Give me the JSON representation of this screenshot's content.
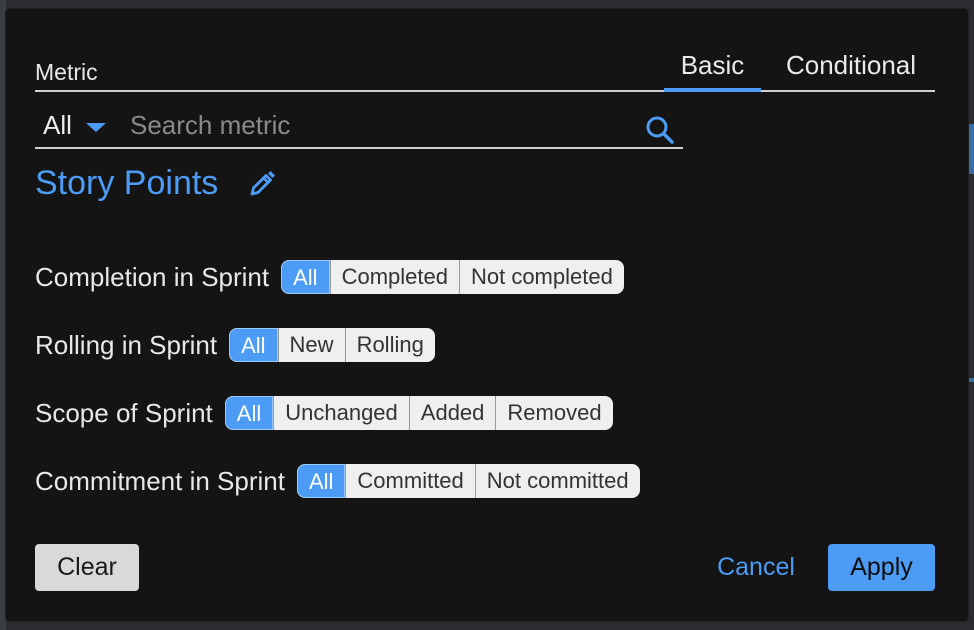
{
  "metric": {
    "label": "Metric",
    "scope_value": "All",
    "search_placeholder": "Search metric",
    "selected_title": "Story Points"
  },
  "tabs": [
    {
      "label": "Basic",
      "active": true
    },
    {
      "label": "Conditional",
      "active": false
    }
  ],
  "filters": [
    {
      "label": "Completion in Sprint",
      "options": [
        "All",
        "Completed",
        "Not completed"
      ],
      "selected": "All"
    },
    {
      "label": "Rolling in Sprint",
      "options": [
        "All",
        "New",
        "Rolling"
      ],
      "selected": "All"
    },
    {
      "label": "Scope of Sprint",
      "options": [
        "All",
        "Unchanged",
        "Added",
        "Removed"
      ],
      "selected": "All"
    },
    {
      "label": "Commitment in Sprint",
      "options": [
        "All",
        "Committed",
        "Not committed"
      ],
      "selected": "All"
    }
  ],
  "actions": {
    "clear_label": "Clear",
    "cancel_label": "Cancel",
    "apply_label": "Apply"
  },
  "colors": {
    "accent": "#4c9bf5",
    "modal_bg": "#141414",
    "segment_bg": "#efefef"
  },
  "icons": {
    "search": "search-icon",
    "edit": "pencil-icon",
    "dropdown": "caret-down-icon"
  }
}
